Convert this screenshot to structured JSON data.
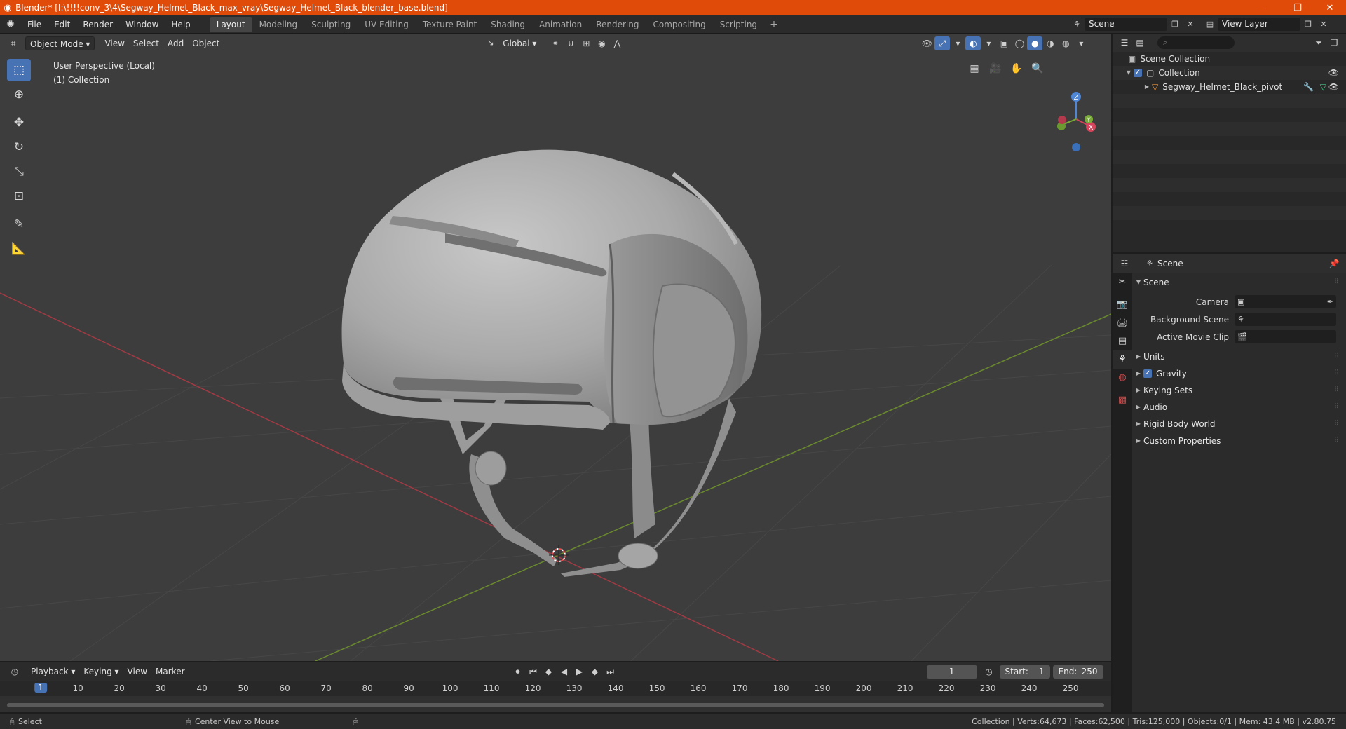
{
  "window": {
    "title": "Blender* [I:\\!!!!conv_3\\4\\Segway_Helmet_Black_max_vray\\Segway_Helmet_Black_blender_base.blend]",
    "controls": [
      "–",
      "❐",
      "✕"
    ]
  },
  "menu": [
    "File",
    "Edit",
    "Render",
    "Window",
    "Help"
  ],
  "workspaces": [
    "Layout",
    "Modeling",
    "Sculpting",
    "UV Editing",
    "Texture Paint",
    "Shading",
    "Animation",
    "Rendering",
    "Compositing",
    "Scripting"
  ],
  "workspace_add": "+",
  "scene": {
    "name": "Scene",
    "view_layer": "View Layer"
  },
  "viewport": {
    "mode": "Object Mode",
    "menus": [
      "View",
      "Select",
      "Add",
      "Object"
    ],
    "transform_orientation": "Global",
    "info_line1": "User Perspective (Local)",
    "info_line2": "(1) Collection",
    "gizmo_labels": {
      "z": "Z",
      "y": "Y",
      "x": "X"
    }
  },
  "outliner": {
    "search_placeholder": "",
    "rows": [
      {
        "label": "Scene Collection"
      },
      {
        "label": "Collection"
      },
      {
        "label": "Segway_Helmet_Black_pivot"
      }
    ]
  },
  "properties": {
    "context": "Scene",
    "panel_title": "Scene",
    "rows": [
      {
        "label": "Camera"
      },
      {
        "label": "Background Scene"
      },
      {
        "label": "Active Movie Clip"
      }
    ],
    "sub_panels": [
      "Units",
      "Gravity",
      "Keying Sets",
      "Audio",
      "Rigid Body World",
      "Custom Properties"
    ]
  },
  "timeline": {
    "menus": [
      "Playback",
      "Keying",
      "View",
      "Marker"
    ],
    "current_frame": "1",
    "start_label": "Start:",
    "start": "1",
    "end_label": "End:",
    "end": "250",
    "ruler": [
      "1",
      "10",
      "20",
      "30",
      "40",
      "50",
      "60",
      "70",
      "80",
      "90",
      "100",
      "110",
      "120",
      "130",
      "140",
      "150",
      "160",
      "170",
      "180",
      "190",
      "200",
      "210",
      "220",
      "230",
      "240",
      "250"
    ]
  },
  "statusbar": {
    "left1": "Select",
    "left2": "Center View to Mouse",
    "right": "Collection | Verts:64,673 | Faces:62,500 | Tris:125,000 | Objects:0/1 | Mem: 43.4 MB | v2.80.75"
  },
  "colors": {
    "accent": "#4772b3",
    "titlebar": "#e14b0a",
    "viewport_bg": "#3d3d3d",
    "x_axis": "#c33c48",
    "y_axis": "#7a9d36"
  }
}
